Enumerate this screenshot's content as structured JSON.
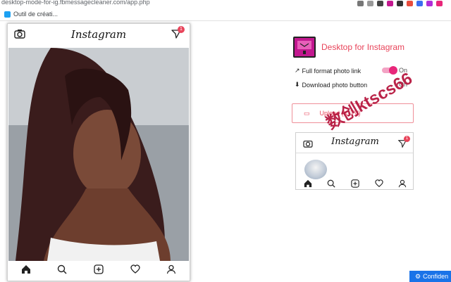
{
  "browser": {
    "url": "desktop-mode-for-ig.fbmessagecleaner.com/app.php",
    "bookmark_label": "Outil de créati..."
  },
  "phone": {
    "logo_text": "Instagram",
    "notification_count": "1"
  },
  "extension": {
    "title": "Desktop for Instagram",
    "options": [
      {
        "label": "Full format photo link",
        "state": "On"
      },
      {
        "label": "Download photo button",
        "state": "On"
      }
    ],
    "upload_label": "Upload (IGTV)",
    "preview_logo_text": "Instagram",
    "preview_notification_count": "1"
  },
  "watermark": {
    "text": "数创ktscs66"
  },
  "footer": {
    "confidential_label": "Confiden"
  },
  "colors": {
    "accent": "#e8445a",
    "toggle": "#e8277a",
    "brand_icon": "#c2188f"
  }
}
